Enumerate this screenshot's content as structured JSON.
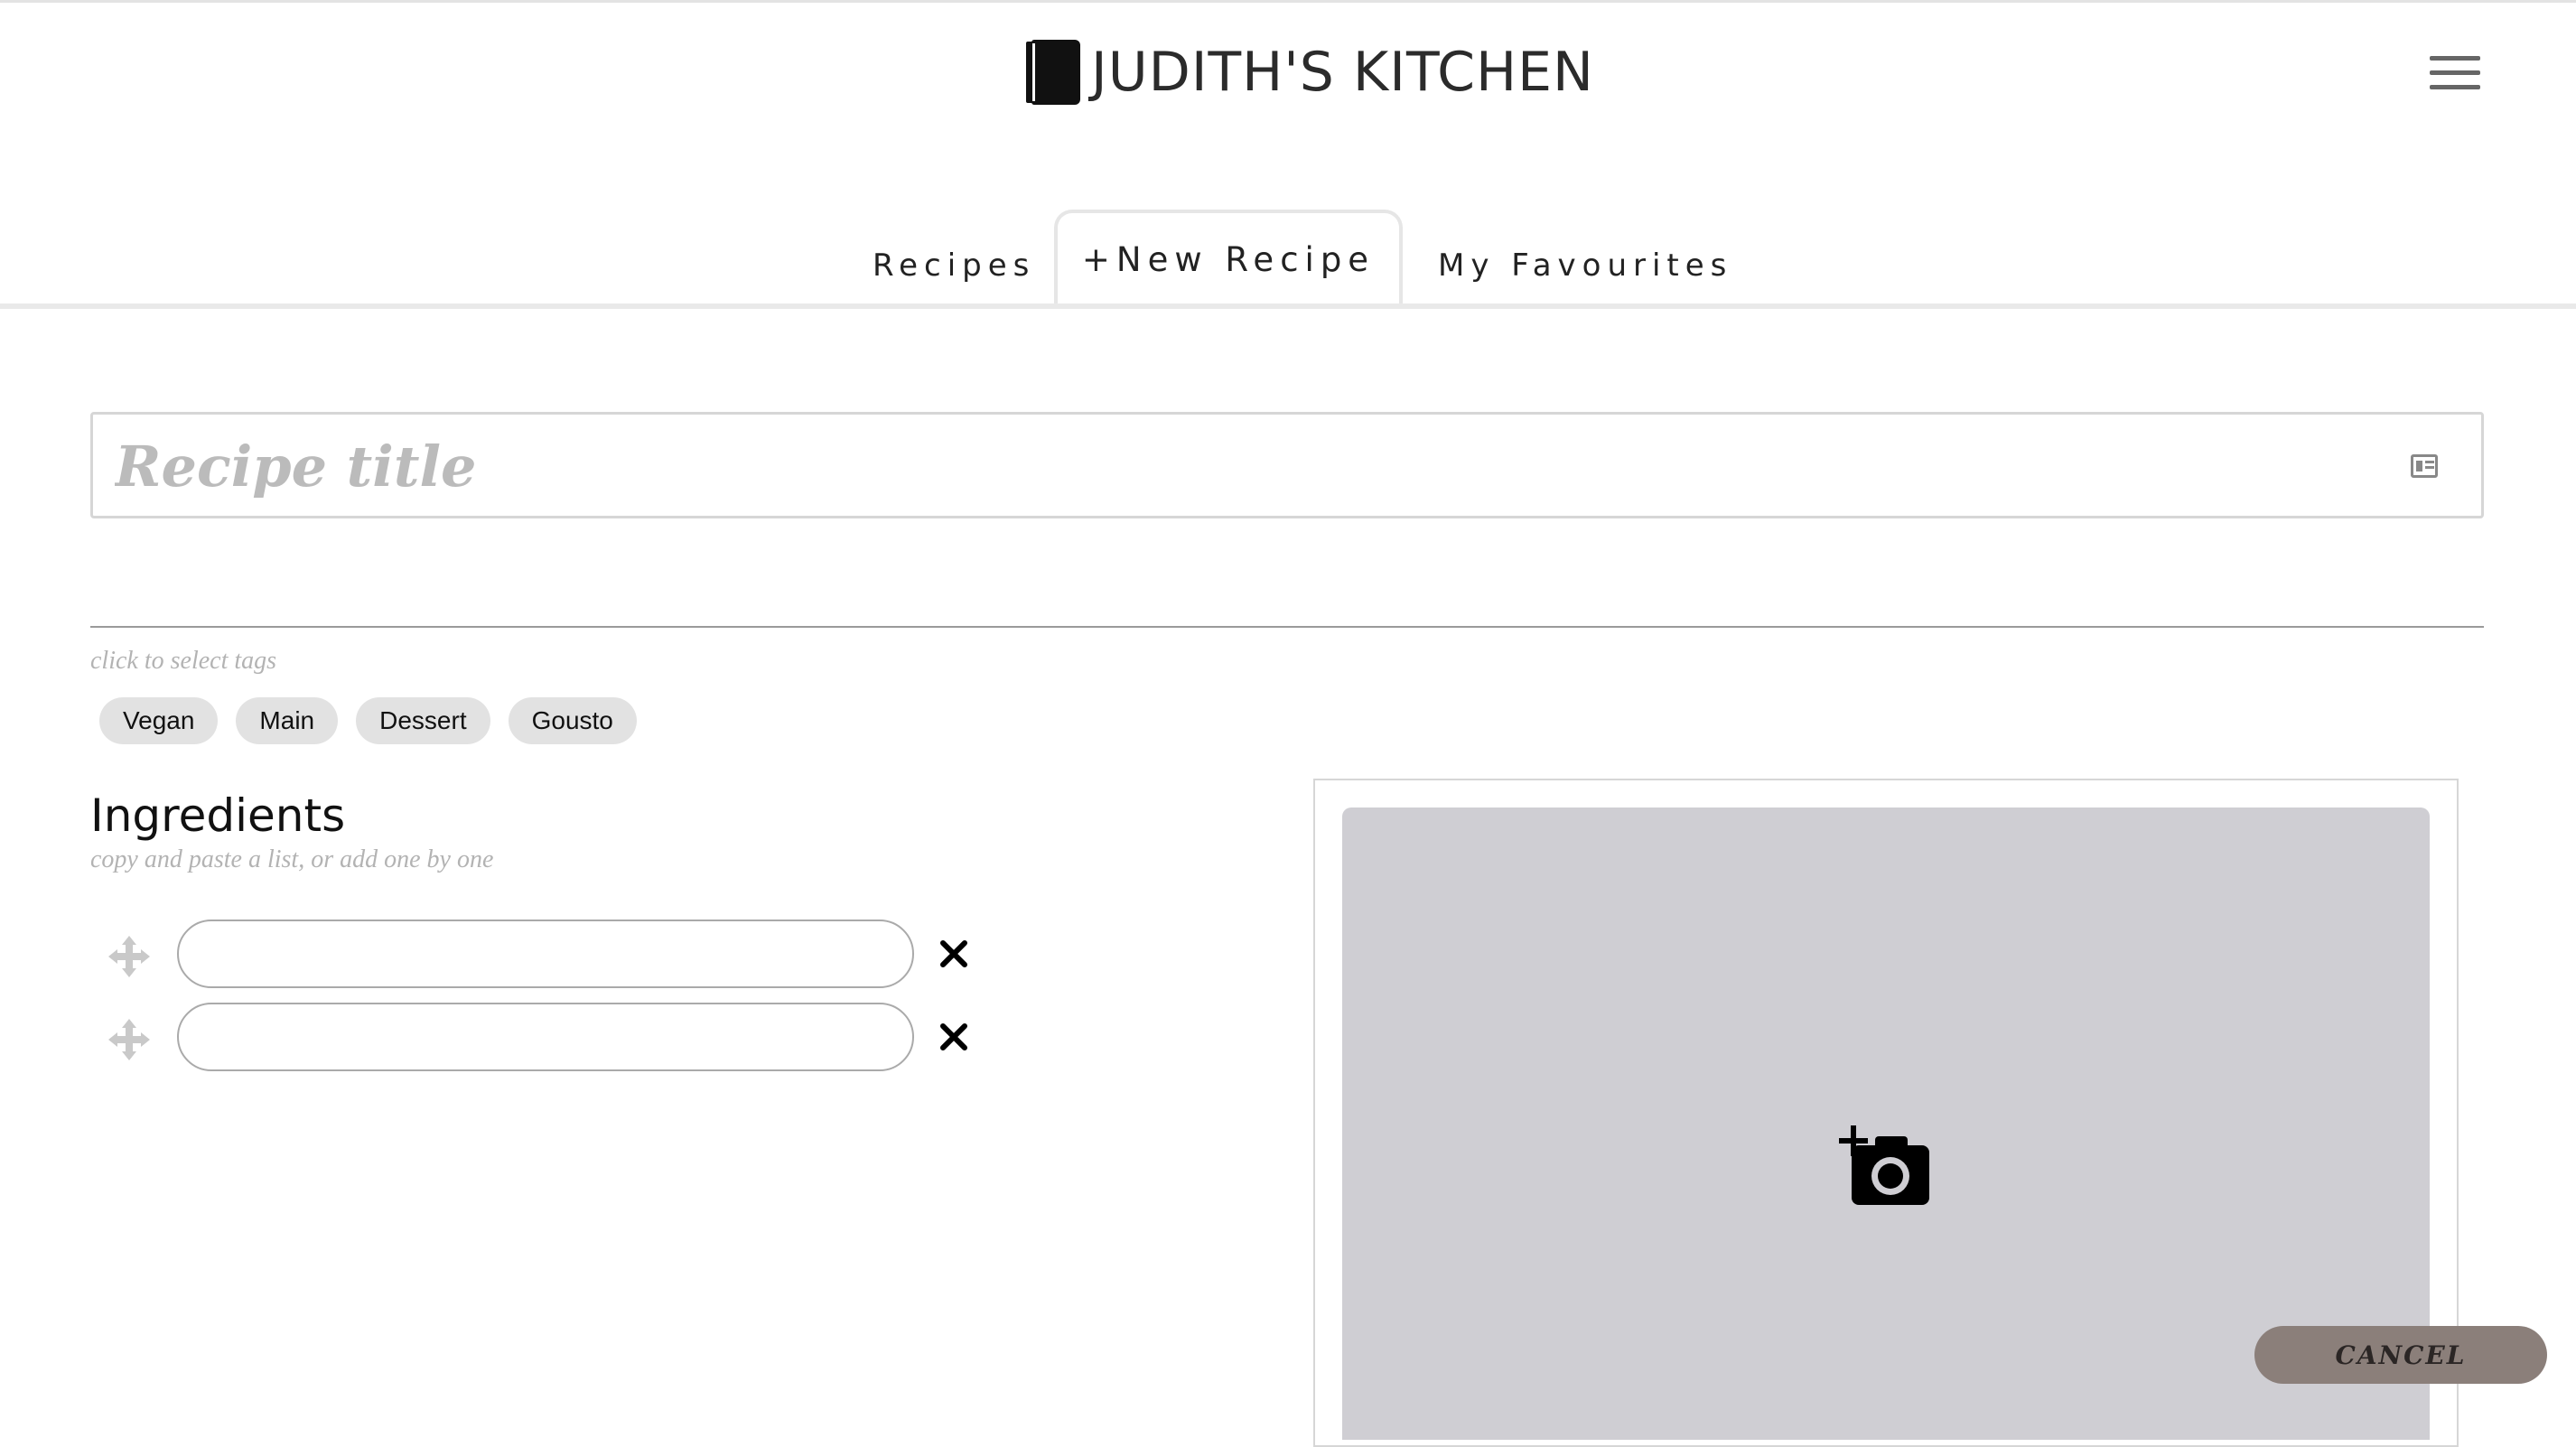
{
  "header": {
    "title": "JUDITH'S KITCHEN",
    "logo_icon": "book-icon",
    "menu_icon": "hamburger-menu-icon"
  },
  "tabs": [
    {
      "label": "Recipes",
      "active": false
    },
    {
      "label": "+New Recipe",
      "active": true
    },
    {
      "label": "My Favourites",
      "active": false
    }
  ],
  "recipe_title": {
    "value": "",
    "placeholder": "Recipe title",
    "icon": "id-card-icon"
  },
  "tags": {
    "hint": "click to select tags",
    "items": [
      "Vegan",
      "Main",
      "Dessert",
      "Gousto"
    ]
  },
  "ingredients": {
    "title": "Ingredients",
    "hint": "copy and paste a list, or add one by one",
    "rows": [
      {
        "value": ""
      },
      {
        "value": ""
      }
    ]
  },
  "image_upload": {
    "icon": "add-photo-camera-icon"
  },
  "actions": {
    "cancel_label": "CANCEL"
  },
  "colors": {
    "tag_bg": "#e2e2e2",
    "image_placeholder_bg": "#cfced3",
    "cancel_bg": "#8b7f7a"
  }
}
